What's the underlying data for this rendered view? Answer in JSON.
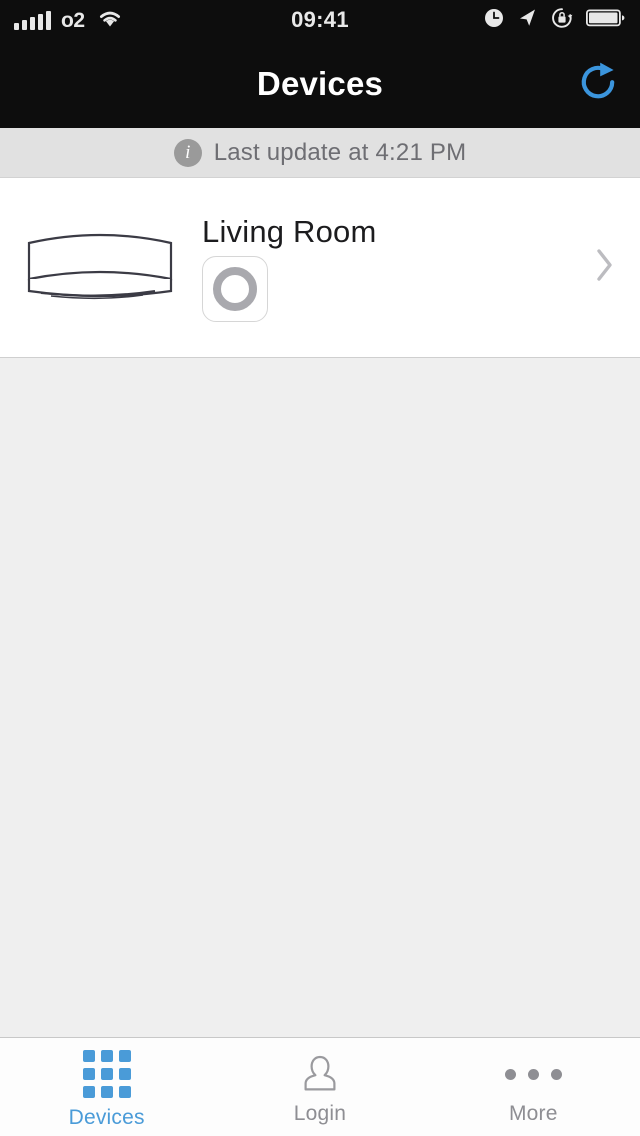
{
  "status_bar": {
    "carrier": "o2",
    "time": "09:41",
    "signal_bars": 5,
    "icons": [
      "signal-bars-icon",
      "wifi-icon",
      "alarm-clock-icon",
      "location-arrow-icon",
      "rotation-lock-icon",
      "battery-icon"
    ],
    "battery_level_percent": 90,
    "background_color": "#0d0d0d",
    "text_color": "#e8e8e8"
  },
  "nav_bar": {
    "title": "Devices",
    "refresh_icon": "refresh-icon",
    "background_color": "#0d0d0d",
    "title_color": "#ffffff",
    "accent_color": "#4a9bd8"
  },
  "banner": {
    "icon": "info-icon",
    "icon_letter": "i",
    "text": "Last update at 4:21 PM",
    "background_color": "#e1e1e1",
    "text_color": "#6e6e73"
  },
  "devices": [
    {
      "name": "Living Room",
      "thumbnail_icon": "air-conditioner-icon",
      "power_state": "off",
      "power_icon": "power-ring-icon",
      "disclosure_icon": "chevron-right-icon"
    }
  ],
  "tab_bar": {
    "active_color": "#4a9bd8",
    "inactive_color": "#8e8e93",
    "items": [
      {
        "label": "Devices",
        "icon": "grid-icon",
        "active": true
      },
      {
        "label": "Login",
        "icon": "person-icon",
        "active": false
      },
      {
        "label": "More",
        "icon": "ellipsis-icon",
        "active": false
      }
    ]
  }
}
